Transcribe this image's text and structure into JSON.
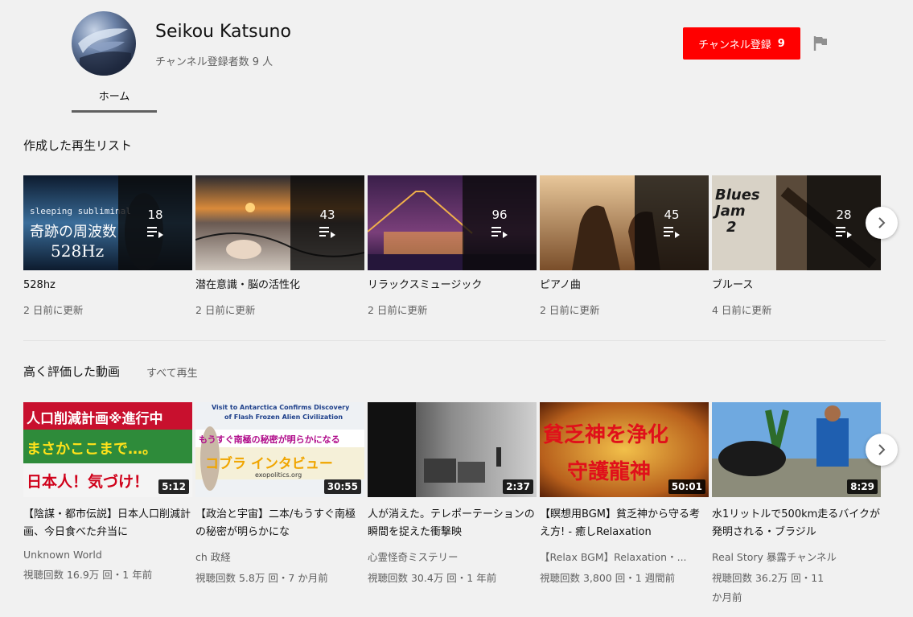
{
  "channel": {
    "name": "Seikou Katsuno",
    "subscribers": "チャンネル登録者数 9 人",
    "subscribe_label": "チャンネル登録",
    "subscribe_count": "9",
    "tabs": [
      {
        "label": "ホーム",
        "selected": true
      }
    ],
    "accent_color": "#ff0000"
  },
  "playlists_section": {
    "title": "作成した再生リスト",
    "items": [
      {
        "title": "528hz",
        "count": "18",
        "updated": "2 日前に更新",
        "thumb_text": [
          "sleeping subliminal",
          "奇跡の周波数",
          "528Hz"
        ]
      },
      {
        "title": "潜在意識・脳の活性化",
        "count": "43",
        "updated": "2 日前に更新"
      },
      {
        "title": "リラックスミュージック",
        "count": "96",
        "updated": "2 日前に更新"
      },
      {
        "title": "ピアノ曲",
        "count": "45",
        "updated": "2 日前に更新"
      },
      {
        "title": "ブルース",
        "count": "28",
        "updated": "4 日前に更新",
        "thumb_text": [
          "Blues",
          "Jam",
          "2"
        ]
      }
    ]
  },
  "liked_section": {
    "title": "高く評価した動画",
    "play_all": "すべて再生",
    "items": [
      {
        "title": "【陰謀・都市伝説】日本人口削減計画、今日食べた弁当に",
        "channel": "Unknown World",
        "meta": "視聴回数 16.9万 回・1 年前",
        "duration": "5:12",
        "thumb_text": [
          "人口削減計画※進行中",
          "まさかここまで…。",
          "日本人！気づけ！"
        ]
      },
      {
        "title": "【政治と宇宙】二本/もうすぐ南極の秘密が明らかにな",
        "channel": "ch 政経",
        "meta": "視聴回数 5.8万 回・7 か月前",
        "duration": "30:55",
        "thumb_text": [
          "Visit to Antarctica Confirms Discovery",
          "of Flash Frozen Alien Civilization",
          "もうすぐ南極の秘密が明らかになる",
          "コブラ インタビュー",
          "exopolitics.org"
        ]
      },
      {
        "title": "人が消えた。テレポーテーションの瞬間を捉えた衝撃映",
        "channel": "心霊怪奇ミステリー",
        "meta": "視聴回数 30.4万 回・1 年前",
        "duration": "2:37"
      },
      {
        "title": "【瞑想用BGM】貧乏神から守る考え方! - 癒しRelaxation",
        "channel": "【Relax BGM】Relaxation・...",
        "meta": "視聴回数 3,800 回・1 週間前",
        "duration": "50:01",
        "thumb_text": [
          "貧乏神を浄化",
          "守護龍神"
        ]
      },
      {
        "title": "水1リットルで500km走るバイクが発明される・ブラジル",
        "channel": "Real Story 暴露チャンネル",
        "meta": "視聴回数 36.2万 回・11 か月前",
        "duration": "8:29"
      }
    ]
  },
  "icons": {
    "flag": "flag-icon",
    "next": "chevron-right-icon",
    "playlist": "playlist-icon"
  }
}
